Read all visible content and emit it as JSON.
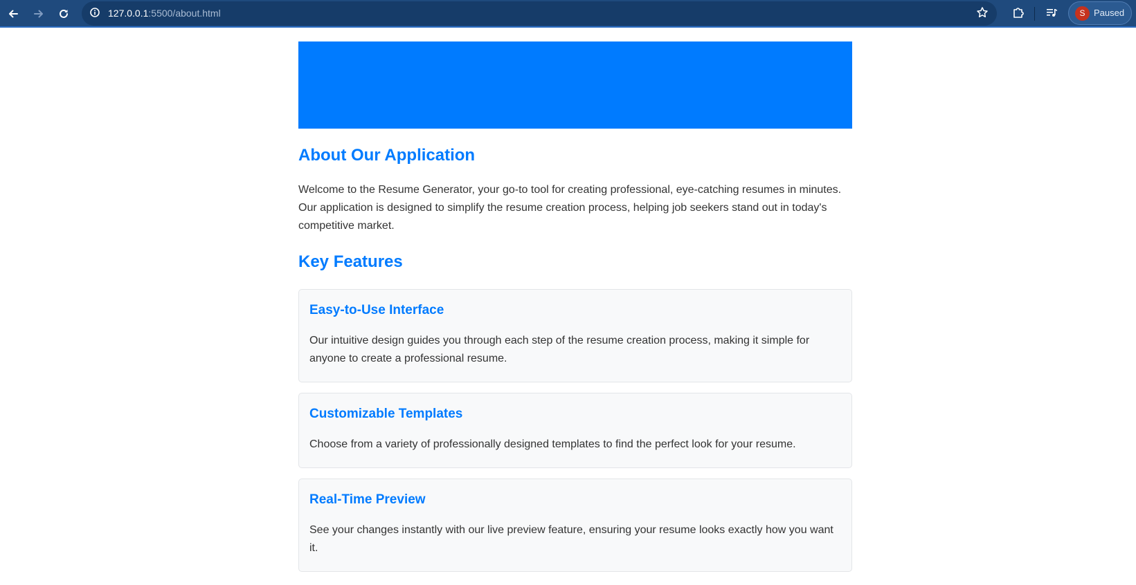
{
  "browser": {
    "url_host": "127.0.0.1",
    "url_path": ":5500/about.html",
    "profile_initial": "S",
    "profile_status": "Paused",
    "icons": {
      "back": "arrow-left-icon",
      "forward": "arrow-right-icon",
      "reload": "reload-icon",
      "site_info": "info-icon",
      "bookmark": "star-icon",
      "extensions": "puzzle-icon",
      "media": "media-controls-icon"
    }
  },
  "colors": {
    "browser_bar": "#1f4a7d",
    "accent": "#007bff",
    "body_text": "#333333",
    "card_bg": "#f8f9fa"
  },
  "about": {
    "heading": "About Our Application",
    "intro": "Welcome to the Resume Generator, your go-to tool for creating professional, eye-catching resumes in minutes. Our application is designed to simplify the resume creation process, helping job seekers stand out in today's competitive market."
  },
  "features": {
    "heading": "Key Features",
    "items": [
      {
        "title": "Easy-to-Use Interface",
        "description": "Our intuitive design guides you through each step of the resume creation process, making it simple for anyone to create a professional resume."
      },
      {
        "title": "Customizable Templates",
        "description": "Choose from a variety of professionally designed templates to find the perfect look for your resume."
      },
      {
        "title": "Real-Time Preview",
        "description": "See your changes instantly with our live preview feature, ensuring your resume looks exactly how you want it."
      }
    ]
  }
}
